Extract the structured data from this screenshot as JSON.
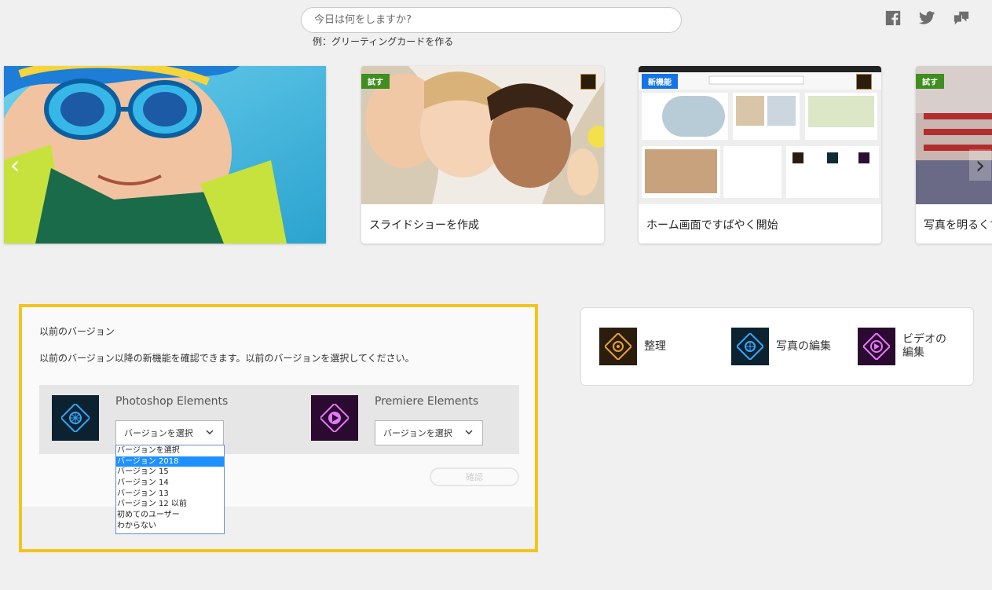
{
  "search": {
    "placeholder": "今日は何をしますか?",
    "example": "例：グリーティングカードを作る"
  },
  "social": {
    "icons": [
      "facebook-icon",
      "twitter-icon",
      "feedback-icon"
    ]
  },
  "carousel": {
    "cards": [
      {
        "caption": "",
        "badge": ""
      },
      {
        "caption": "スライドショーを作成",
        "badge": "試す"
      },
      {
        "caption": "ホーム画面ですばやく開始",
        "badge": "新機能"
      },
      {
        "caption": "写真を明るくす",
        "badge": "試す"
      }
    ],
    "prev_arrow": "‹",
    "next_arrow": "›"
  },
  "previous_version": {
    "title": "以前のバージョン",
    "description": "以前のバージョン以降の新機能を確認できます。以前のバージョンを選択してください。",
    "photoshop": {
      "name": "Photoshop Elements",
      "select_value": "バージョンを選択"
    },
    "premiere": {
      "name": "Premiere Elements",
      "select_value": "バージョンを選択"
    },
    "confirm_label": "確認",
    "dropdown_options": [
      "バージョンを選択",
      "バージョン 2018",
      "バージョン 15",
      "バージョン 14",
      "バージョン 13",
      "バージョン 12 以前",
      "初めてのユーザー",
      "わからない"
    ],
    "dropdown_selected_index": 1
  },
  "quick_links": [
    {
      "label": "整理",
      "icon": "organizer-icon"
    },
    {
      "label": "写真の編集",
      "icon": "photo-edit-icon"
    },
    {
      "label": "ビデオの編集",
      "icon": "video-edit-icon"
    }
  ],
  "colors": {
    "highlight_border": "#f4c41a",
    "badge_green": "#3f8e1f",
    "badge_blue": "#1473e6",
    "selection": "#1e90ff"
  }
}
